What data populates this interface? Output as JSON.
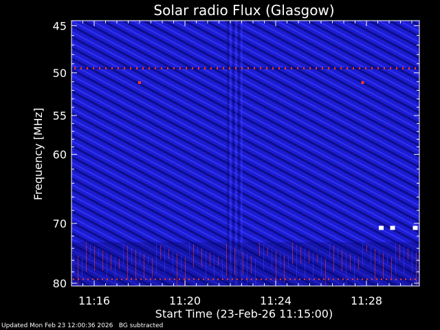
{
  "chart_data": {
    "type": "heatmap",
    "title": "Solar radio Flux (Glasgow)",
    "xlabel": "Start Time (23-Feb-26 11:15:00)",
    "ylabel": "Frequency [MHz]",
    "x_range_minutes": [
      "11:15:00",
      "11:30:20"
    ],
    "x_ticks": [
      "11:16",
      "11:20",
      "11:24",
      "11:28"
    ],
    "y_ticks": [
      45,
      50,
      55,
      60,
      70,
      80
    ],
    "y_range_mhz": [
      44.5,
      80.5
    ],
    "y_scale": "log",
    "colormap": {
      "background": "#1c1cd0",
      "dark": "#0a0a70",
      "light": "#3b3bff",
      "hot": "#ff3b1c",
      "peak": "#ffffff"
    },
    "features": {
      "interference_line_mhz": 49.5,
      "bright_points": [
        {
          "time": "11:18",
          "mhz": 51.1
        },
        {
          "time": "11:27:50",
          "mhz": 51.1
        },
        {
          "time": "11:28:40",
          "mhz": 70.7
        },
        {
          "time": "11:29:10",
          "mhz": 70.7
        },
        {
          "time": "11:30:10",
          "mhz": 70.7
        }
      ],
      "vertical_stripe_time": "11:22:10",
      "lower_band_mhz": 79.3
    }
  },
  "footer": {
    "updated": "Updated Mon Feb 23 12:00:36 2026",
    "note": "BG subtracted"
  }
}
